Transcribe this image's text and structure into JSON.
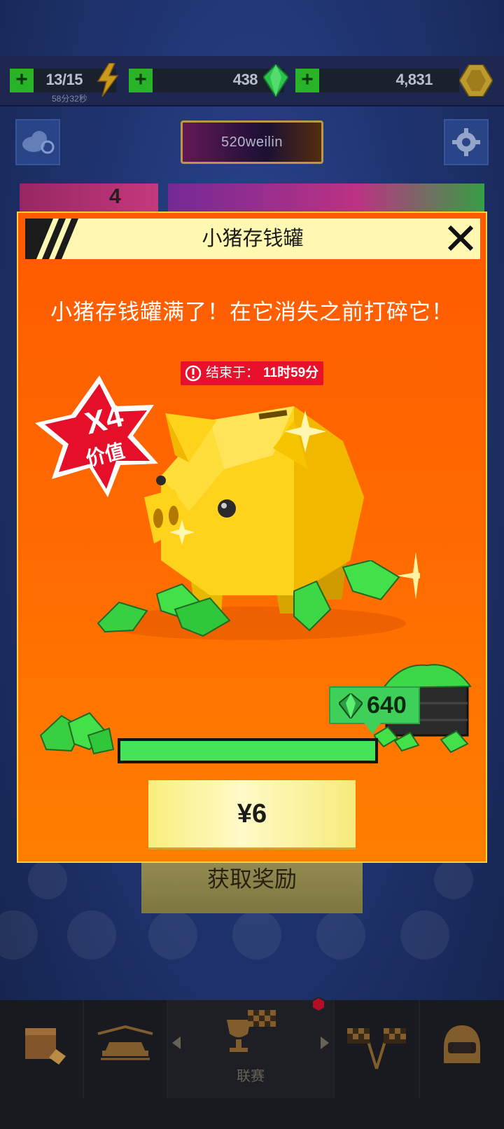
{
  "resources": {
    "energy": {
      "value": "13/15",
      "timer": "58分32秒"
    },
    "gems": {
      "value": "438"
    },
    "coins": {
      "value": "4,831"
    }
  },
  "header": {
    "username": "520weilin"
  },
  "behind_card": {
    "count": "4"
  },
  "behind_button": {
    "label": "获取奖励"
  },
  "bottom_nav": {
    "items": [
      {
        "icon": "shop-icon"
      },
      {
        "icon": "garage-car-icon"
      },
      {
        "icon": "trophy-flags-icon",
        "label": "联赛"
      },
      {
        "icon": "checkered-flags-icon"
      },
      {
        "icon": "helmet-icon"
      }
    ]
  },
  "modal": {
    "title": "小猪存钱罐",
    "message": "小猪存钱罐满了！在它消失之前打碎它！",
    "timer_prefix": "结束于：",
    "timer_value": "11时59分",
    "badge_main": "X4",
    "badge_sub": "价值",
    "gem_amount": "640",
    "progress": 1.0,
    "price_label": "¥6"
  },
  "colors": {
    "modal_orange": "#ff6a00",
    "header_cream": "#fff8b2",
    "gem_green": "#45e35a",
    "price_yellow": "#f8ee7e",
    "badge_red": "#e8102a"
  }
}
